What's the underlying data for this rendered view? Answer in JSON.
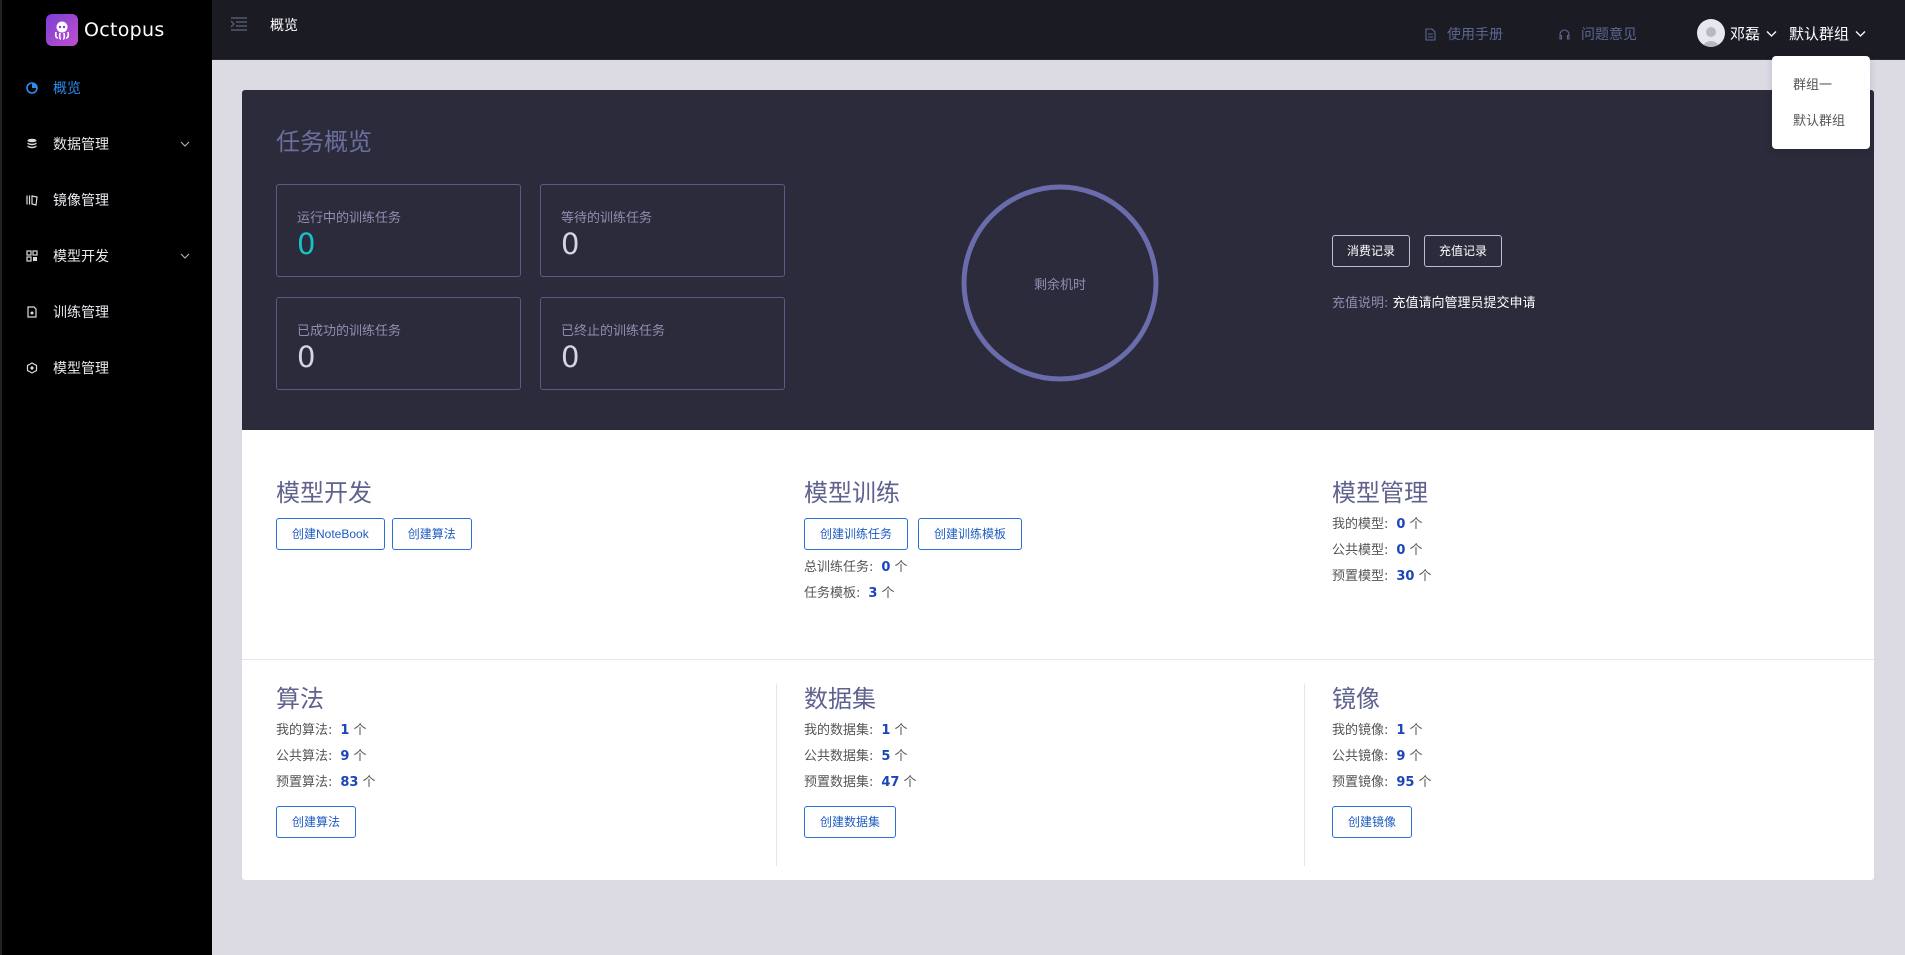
{
  "brand": {
    "name": "Octopus"
  },
  "header": {
    "crumb": "概览",
    "manual": "使用手册",
    "feedback": "问题意见",
    "user": "邓磊",
    "group": "默认群组"
  },
  "dropdown": {
    "items": [
      "群组一",
      "默认群组"
    ]
  },
  "sidebar": {
    "items": [
      {
        "label": "概览",
        "icon": "dashboard-icon",
        "active": true
      },
      {
        "label": "数据管理",
        "icon": "database-icon",
        "expandable": true
      },
      {
        "label": "镜像管理",
        "icon": "image-icon"
      },
      {
        "label": "模型开发",
        "icon": "dev-icon",
        "expandable": true
      },
      {
        "label": "训练管理",
        "icon": "training-icon"
      },
      {
        "label": "模型管理",
        "icon": "model-icon"
      }
    ]
  },
  "overview": {
    "title": "任务概览",
    "running_label": "运行中的训练任务",
    "running_value": "0",
    "waiting_label": "等待的训练任务",
    "waiting_value": "0",
    "success_label": "已成功的训练任务",
    "success_value": "0",
    "stopped_label": "已终止的训练任务",
    "stopped_value": "0",
    "remaining_label": "剩余机时",
    "consume_button": "消费记录",
    "recharge_button": "充值记录",
    "recharge_note_label": "充值说明:",
    "recharge_note_text": "充值请向管理员提交申请"
  },
  "model_dev": {
    "title": "模型开发",
    "create_notebook": "创建NoteBook",
    "create_algorithm": "创建算法"
  },
  "model_train": {
    "title": "模型训练",
    "create_task": "创建训练任务",
    "create_template": "创建训练模板",
    "total_label": "总训练任务:",
    "total_value": "0",
    "template_label": "任务模板:",
    "template_value": "3",
    "unit": "个"
  },
  "model_mgmt": {
    "title": "模型管理",
    "my_label": "我的模型:",
    "my_value": "0",
    "public_label": "公共模型:",
    "public_value": "0",
    "preset_label": "预置模型:",
    "preset_value": "30",
    "unit": "个"
  },
  "algorithm": {
    "title": "算法",
    "my_label": "我的算法:",
    "my_value": "1",
    "public_label": "公共算法:",
    "public_value": "9",
    "preset_label": "预置算法:",
    "preset_value": "83",
    "unit": "个",
    "create": "创建算法"
  },
  "dataset": {
    "title": "数据集",
    "my_label": "我的数据集:",
    "my_value": "1",
    "public_label": "公共数据集:",
    "public_value": "5",
    "preset_label": "预置数据集:",
    "preset_value": "47",
    "unit": "个",
    "create": "创建数据集"
  },
  "image": {
    "title": "镜像",
    "my_label": "我的镜像:",
    "my_value": "1",
    "public_label": "公共镜像:",
    "public_value": "9",
    "preset_label": "预置镜像:",
    "preset_value": "95",
    "unit": "个",
    "create": "创建镜像"
  }
}
